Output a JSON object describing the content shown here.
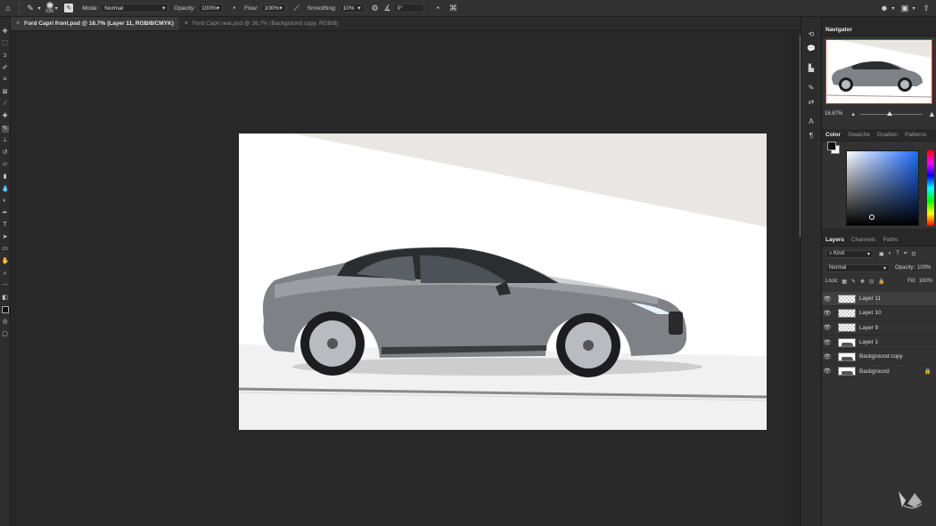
{
  "options_bar": {
    "brush_size": "236",
    "mode_label": "Mode:",
    "mode_value": "Normal",
    "opacity_label": "Opacity:",
    "opacity_value": "100%",
    "flow_label": "Flow:",
    "flow_value": "100%",
    "smoothing_label": "Smoothing:",
    "smoothing_value": "10%",
    "angle_value": "0°"
  },
  "tabs": [
    {
      "label": "Ford Capri front.psd @ 16.7% (Layer 11, RGB/8/CMYK)",
      "active": true
    },
    {
      "label": "Ford Capri rear.psd @ 16.7% (Background copy, RGB/8)",
      "active": false
    }
  ],
  "navigator": {
    "title": "Navigator",
    "zoom": "16.67%"
  },
  "color_panel": {
    "tabs": [
      "Color",
      "Swatche",
      "Gradien",
      "Patterns"
    ],
    "foreground": "#111111",
    "background": "#ffffff"
  },
  "layers_panel": {
    "tabs": [
      "Layers",
      "Channels",
      "Paths"
    ],
    "filter_label": "Kind",
    "blend_mode": "Normal",
    "opacity_label": "Opacity:",
    "opacity_value": "100%",
    "lock_label": "Lock:",
    "fill_label": "Fill:",
    "fill_value": "100%",
    "layers": [
      {
        "name": "Layer 11",
        "selected": true,
        "thumb": "checker"
      },
      {
        "name": "Layer 10",
        "selected": false,
        "thumb": "checker"
      },
      {
        "name": "Layer 9",
        "selected": false,
        "thumb": "checker"
      },
      {
        "name": "Layer 1",
        "selected": false,
        "thumb": "img"
      },
      {
        "name": "Background copy",
        "selected": false,
        "thumb": "img"
      },
      {
        "name": "Background",
        "selected": false,
        "thumb": "img",
        "locked": true
      }
    ]
  },
  "colors": {
    "accent_red": "#e0342b",
    "panel": "#323232",
    "canvas_bg": "#282828"
  }
}
